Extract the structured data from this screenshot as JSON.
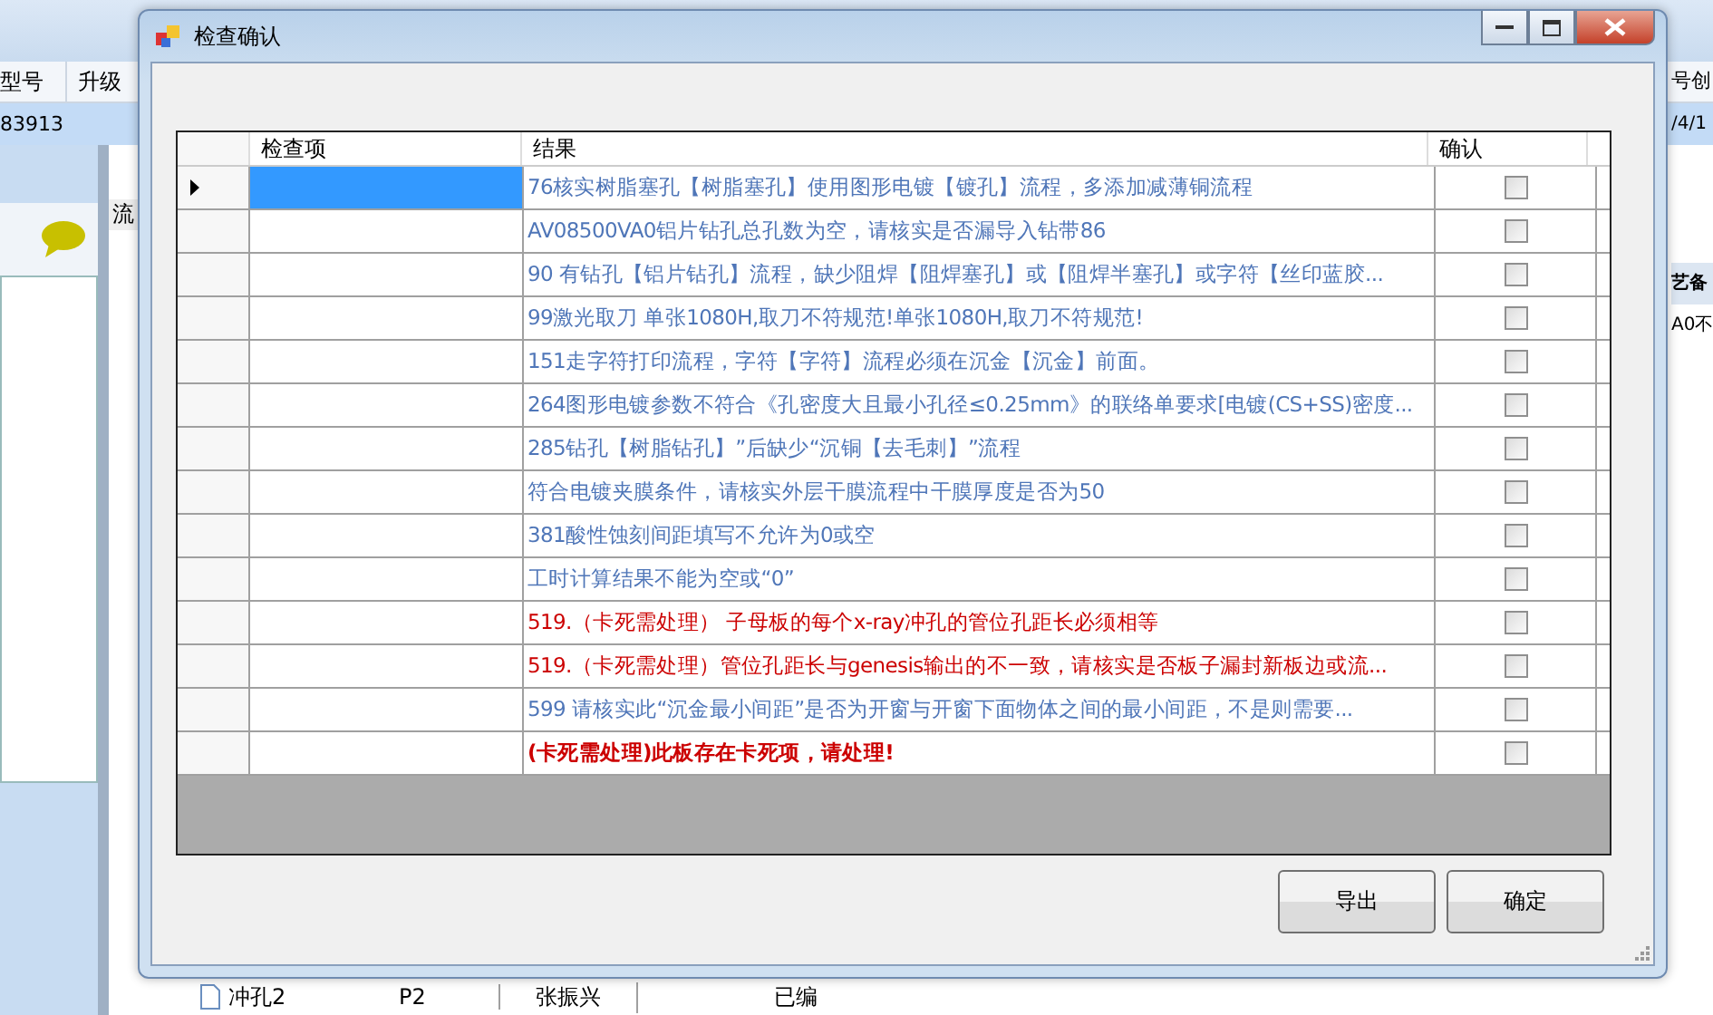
{
  "background_app": {
    "columns": [
      "型号",
      "升级"
    ],
    "row_cells": [
      "83913"
    ],
    "right_column": "号创",
    "right_cell": "/4/1",
    "flow_tab": "流",
    "side_texts": [
      "艺备",
      "A0不"
    ],
    "tree_row": {
      "name": "冲孔2",
      "code": "P2",
      "person": "张振兴",
      "status": "已编"
    }
  },
  "dialog": {
    "title": "检查确认",
    "columns": [
      "检查项",
      "结果",
      "确认"
    ],
    "rows": [
      {
        "result": "76核实树脂塞孔【树脂塞孔】使用图形电镀【镀孔】流程，多添加减薄铜流程",
        "kind": "info",
        "selected": true,
        "checked": false
      },
      {
        "result": "AV08500VA0铝片钻孔总孔数为空，请核实是否漏导入钻带86",
        "kind": "info",
        "selected": false,
        "checked": false
      },
      {
        "result": "90 有钻孔【铝片钻孔】流程，缺少阻焊【阻焊塞孔】或【阻焊半塞孔】或字符【丝印蓝胶...",
        "kind": "info",
        "selected": false,
        "checked": false
      },
      {
        "result": "99激光取刀 单张1080H,取刀不符规范!单张1080H,取刀不符规范!",
        "kind": "info",
        "selected": false,
        "checked": false
      },
      {
        "result": "151走字符打印流程，字符【字符】流程必须在沉金【沉金】前面。",
        "kind": "info",
        "selected": false,
        "checked": false
      },
      {
        "result": "264图形电镀参数不符合《孔密度大且最小孔径≤0.25mm》的联络单要求[电镀(CS+SS)密度...",
        "kind": "info",
        "selected": false,
        "checked": false
      },
      {
        "result": "285钻孔【树脂钻孔】”后缺少“沉铜【去毛刺】”流程",
        "kind": "info",
        "selected": false,
        "checked": false
      },
      {
        "result": "符合电镀夹膜条件，请核实外层干膜流程中干膜厚度是否为50",
        "kind": "info",
        "selected": false,
        "checked": false
      },
      {
        "result": "381酸性蚀刻间距填写不允许为0或空",
        "kind": "info",
        "selected": false,
        "checked": false
      },
      {
        "result": "工时计算结果不能为空或“0”",
        "kind": "info",
        "selected": false,
        "checked": false
      },
      {
        "result": "519.（卡死需处理） 子母板的每个x-ray冲孔的管位孔距长必须相等",
        "kind": "error",
        "selected": false,
        "checked": false
      },
      {
        "result": "519.（卡死需处理）管位孔距长与genesis输出的不一致，请核实是否板子漏封新板边或流...",
        "kind": "error",
        "selected": false,
        "checked": false
      },
      {
        "result": "599 请核实此“沉金最小间距”是否为开窗与开窗下面物体之间的最小间距，不是则需要...",
        "kind": "info",
        "selected": false,
        "checked": false
      },
      {
        "result": "(卡死需处理)此板存在卡死项，请处理!",
        "kind": "fatal",
        "selected": false,
        "checked": false
      }
    ],
    "buttons": [
      "导出",
      "确定"
    ]
  }
}
